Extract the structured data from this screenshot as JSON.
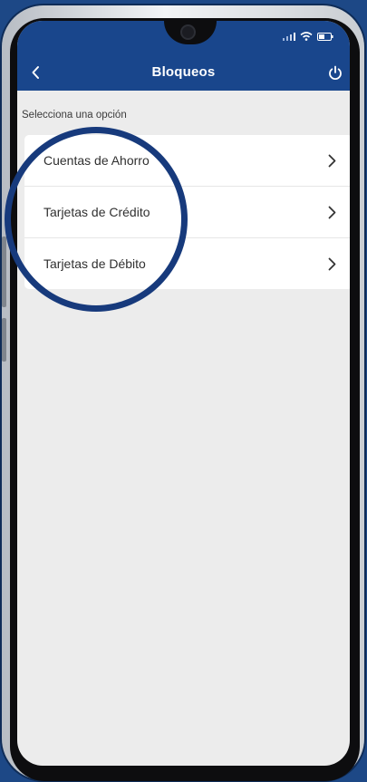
{
  "header": {
    "title": "Bloqueos",
    "back_icon": "chevron-left-icon",
    "power_icon": "power-icon",
    "color": "#19468c"
  },
  "status_bar": {
    "icons": [
      "signal-icon",
      "wifi-icon",
      "battery-icon"
    ]
  },
  "main": {
    "section_label": "Selecciona una opción",
    "items": [
      {
        "label": "Cuentas de Ahorro",
        "icon": "chevron-right-icon"
      },
      {
        "label": "Tarjetas de Crédito",
        "icon": "chevron-right-icon"
      },
      {
        "label": "Tarjetas de Débito",
        "icon": "chevron-right-icon"
      }
    ]
  },
  "colors": {
    "page_background": "#1d4886",
    "screen_background": "#ececec",
    "highlight_circle": "#173a7c"
  }
}
